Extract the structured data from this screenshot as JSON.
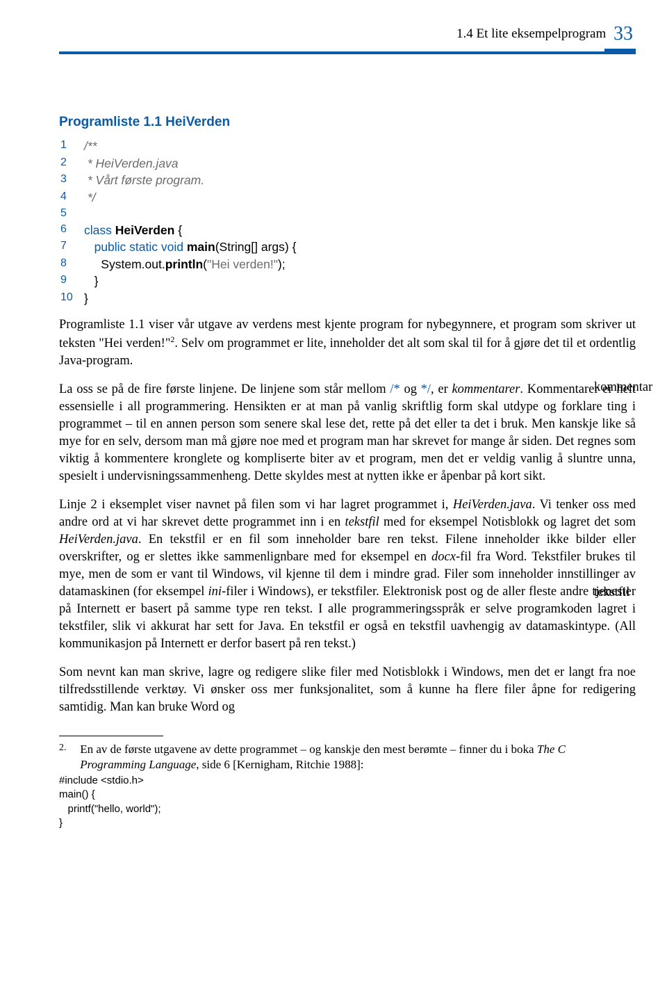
{
  "header": {
    "section": "1.4  Et lite eksempelprogram",
    "page": "33"
  },
  "listing": {
    "title": "Programliste 1.1 HeiVerden",
    "lines": {
      "l1": {
        "n": "1",
        "c1": "/**"
      },
      "l2": {
        "n": "2",
        "c1": " * HeiVerden.java"
      },
      "l3": {
        "n": "3",
        "c1": " * Vårt første program."
      },
      "l4": {
        "n": "4",
        "c1": " */"
      },
      "l5": {
        "n": "5",
        "c1": ""
      },
      "l6": {
        "n": "6",
        "k1": "class",
        "i1": " HeiVerden",
        "p1": " {"
      },
      "l7": {
        "n": "7",
        "k1": "   public static void",
        "i1": " main",
        "p1": "(String[] args) {"
      },
      "l8": {
        "n": "8",
        "p0": "     System.out.",
        "i1": "println",
        "p1": "(",
        "s1": "\"Hei verden!\"",
        "p2": ");"
      },
      "l9": {
        "n": "9",
        "p1": "   }"
      },
      "l10": {
        "n": "10",
        "p1": "}"
      }
    }
  },
  "paragraphs": {
    "p1a": "Programliste 1.1 viser vår utgave av verdens mest kjente program for nybegynnere, et program som skriver ut teksten \"Hei verden!\"",
    "p1sup": "2",
    "p1b": ". Selv om programmet er lite, inneholder det alt som skal til for å gjøre det til et ordentlig Java-program.",
    "p2a": "La oss se på de fire første linjene. De linjene som står mellom ",
    "p2s1": "/*",
    "p2b": " og ",
    "p2s2": "*/",
    "p2c": ", er  ",
    "p2i1": "kommentarer",
    "p2d": ". Kommentarer er helt essensielle i all programmering. Hensikten er at man på vanlig skriftlig form skal utdype og forklare ting i programmet – til en annen person som senere skal lese det, rette på det eller ta det i bruk. Men kanskje like så mye for en selv, dersom man må gjøre noe med et program man har skrevet for mange år siden. Det regnes som viktig å kommentere kronglete og kompliserte biter av et program, men det er veldig vanlig å sluntre unna, spesielt i undervisningssammenheng. Dette skyldes mest at nytten ikke er åpenbar på kort sikt.",
    "p3a": "Linje 2 i eksemplet viser navnet på filen som vi har lagret programmet i, ",
    "p3i1": "HeiVerden.java",
    "p3b": ". Vi tenker oss med andre ord at vi har skrevet dette programmet inn i en ",
    "p3i2": "tekstfil",
    "p3c": " med for eksempel Notisblokk og lagret det som ",
    "p3i3": "HeiVerden.java",
    "p3d": ". En tekstfil er en fil som inneholder bare ren tekst. Filene inneholder ikke bilder eller overskrifter, og er slettes ikke sammenlignbare med for eksempel en ",
    "p3i4": "docx",
    "p3e": "-fil fra Word. Tekstfiler brukes til mye, men de som er vant til Windows, vil kjenne til dem i mindre grad. Filer som inneholder innstillinger av datamaskinen (for eksempel ",
    "p3i5": "ini",
    "p3f": "-filer i Windows), er tekstfiler. Elektronisk post og de aller fleste andre tjenester på Internett er basert på samme type ren tekst. I alle programmeringsspråk er selve programkoden lagret i tekstfiler, slik vi akkurat har sett for Java. En tekstfil er også en tekstfil uavhengig av datamaskintype. (All kommunikasjon på Internett er derfor basert på ren tekst.)",
    "p4": "Som nevnt kan man skrive, lagre og redigere slike filer med Notisblokk i Windows, men det er langt fra noe tilfredsstillende verktøy. Vi ønsker oss mer funksjonalitet, som å kunne ha flere filer åpne for redigering samtidig. Man kan bruke Word og"
  },
  "margin": {
    "m1": "kommentar",
    "m2": "tekstfil"
  },
  "footnote": {
    "num": "2.",
    "text_a": "En av de første utgavene av dette programmet – og kanskje den mest berømte – finner du i boka ",
    "text_i": "The C Programming Language",
    "text_b": ", side 6  [Kernigham, Ritchie 1988]:",
    "code": {
      "c1": "#include <stdio.h>",
      "c2": "main() {",
      "c3": "   printf(\"hello, world\");",
      "c4": "}"
    }
  }
}
